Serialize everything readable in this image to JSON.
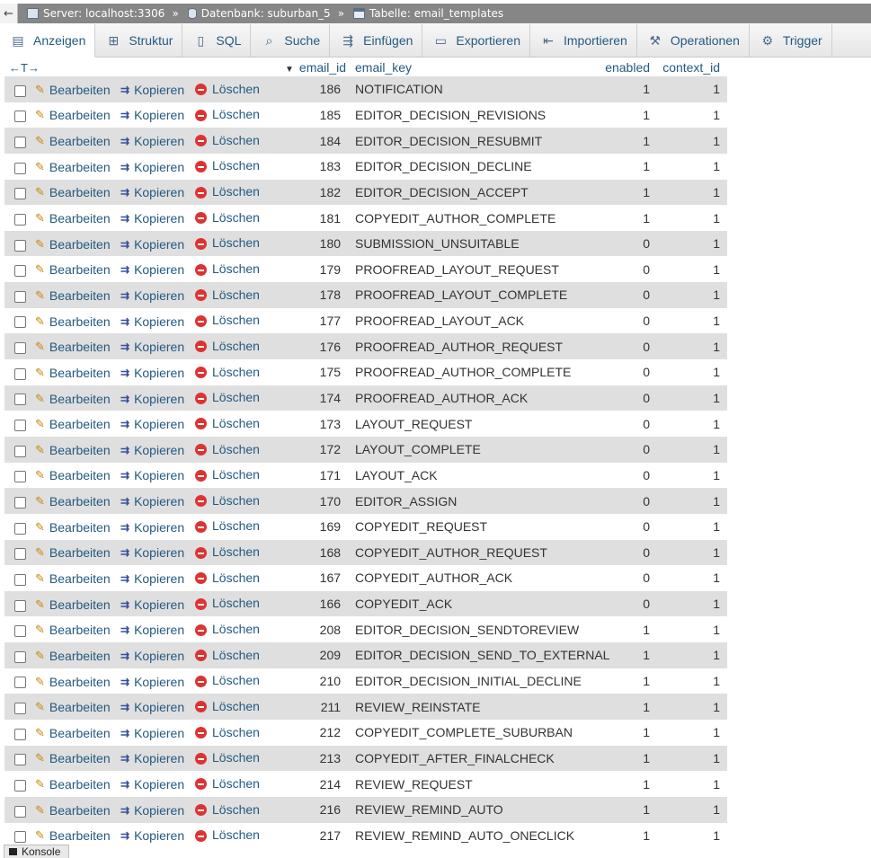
{
  "breadcrumb": {
    "back": "←",
    "server": "Server: localhost:3306",
    "database": "Datenbank: suburban_5",
    "table": "Tabelle: email_templates",
    "separator": "»"
  },
  "tabs": [
    {
      "label": "Anzeigen",
      "icon": "browse-icon",
      "glyph": "▤",
      "active": true
    },
    {
      "label": "Struktur",
      "icon": "structure-icon",
      "glyph": "⊞",
      "active": false
    },
    {
      "label": "SQL",
      "icon": "sql-icon",
      "glyph": "▯",
      "active": false
    },
    {
      "label": "Suche",
      "icon": "search-icon",
      "glyph": "⌕",
      "active": false
    },
    {
      "label": "Einfügen",
      "icon": "insert-icon",
      "glyph": "⇶",
      "active": false
    },
    {
      "label": "Exportieren",
      "icon": "export-icon",
      "glyph": "▭",
      "active": false
    },
    {
      "label": "Importieren",
      "icon": "import-icon",
      "glyph": "⇤",
      "active": false
    },
    {
      "label": "Operationen",
      "icon": "operations-icon",
      "glyph": "⚒",
      "active": false
    },
    {
      "label": "Trigger",
      "icon": "trigger-icon",
      "glyph": "⚙",
      "active": false
    }
  ],
  "table": {
    "resize_glyph": "←T→",
    "sort_glyph": "▼",
    "columns": {
      "email_id": "email_id",
      "email_key": "email_key",
      "enabled": "enabled",
      "context_id": "context_id"
    },
    "actions": {
      "edit": "Bearbeiten",
      "copy": "Kopieren",
      "delete": "Löschen"
    },
    "rows": [
      {
        "email_id": "186",
        "email_key": "NOTIFICATION",
        "enabled": "1",
        "context_id": "1"
      },
      {
        "email_id": "185",
        "email_key": "EDITOR_DECISION_REVISIONS",
        "enabled": "1",
        "context_id": "1"
      },
      {
        "email_id": "184",
        "email_key": "EDITOR_DECISION_RESUBMIT",
        "enabled": "1",
        "context_id": "1"
      },
      {
        "email_id": "183",
        "email_key": "EDITOR_DECISION_DECLINE",
        "enabled": "1",
        "context_id": "1"
      },
      {
        "email_id": "182",
        "email_key": "EDITOR_DECISION_ACCEPT",
        "enabled": "1",
        "context_id": "1"
      },
      {
        "email_id": "181",
        "email_key": "COPYEDIT_AUTHOR_COMPLETE",
        "enabled": "1",
        "context_id": "1"
      },
      {
        "email_id": "180",
        "email_key": "SUBMISSION_UNSUITABLE",
        "enabled": "0",
        "context_id": "1"
      },
      {
        "email_id": "179",
        "email_key": "PROOFREAD_LAYOUT_REQUEST",
        "enabled": "0",
        "context_id": "1"
      },
      {
        "email_id": "178",
        "email_key": "PROOFREAD_LAYOUT_COMPLETE",
        "enabled": "0",
        "context_id": "1"
      },
      {
        "email_id": "177",
        "email_key": "PROOFREAD_LAYOUT_ACK",
        "enabled": "0",
        "context_id": "1"
      },
      {
        "email_id": "176",
        "email_key": "PROOFREAD_AUTHOR_REQUEST",
        "enabled": "0",
        "context_id": "1"
      },
      {
        "email_id": "175",
        "email_key": "PROOFREAD_AUTHOR_COMPLETE",
        "enabled": "0",
        "context_id": "1"
      },
      {
        "email_id": "174",
        "email_key": "PROOFREAD_AUTHOR_ACK",
        "enabled": "0",
        "context_id": "1"
      },
      {
        "email_id": "173",
        "email_key": "LAYOUT_REQUEST",
        "enabled": "0",
        "context_id": "1"
      },
      {
        "email_id": "172",
        "email_key": "LAYOUT_COMPLETE",
        "enabled": "0",
        "context_id": "1"
      },
      {
        "email_id": "171",
        "email_key": "LAYOUT_ACK",
        "enabled": "0",
        "context_id": "1"
      },
      {
        "email_id": "170",
        "email_key": "EDITOR_ASSIGN",
        "enabled": "0",
        "context_id": "1"
      },
      {
        "email_id": "169",
        "email_key": "COPYEDIT_REQUEST",
        "enabled": "0",
        "context_id": "1"
      },
      {
        "email_id": "168",
        "email_key": "COPYEDIT_AUTHOR_REQUEST",
        "enabled": "0",
        "context_id": "1"
      },
      {
        "email_id": "167",
        "email_key": "COPYEDIT_AUTHOR_ACK",
        "enabled": "0",
        "context_id": "1"
      },
      {
        "email_id": "166",
        "email_key": "COPYEDIT_ACK",
        "enabled": "0",
        "context_id": "1"
      },
      {
        "email_id": "208",
        "email_key": "EDITOR_DECISION_SENDTOREVIEW",
        "enabled": "1",
        "context_id": "1"
      },
      {
        "email_id": "209",
        "email_key": "EDITOR_DECISION_SEND_TO_EXTERNAL",
        "enabled": "1",
        "context_id": "1"
      },
      {
        "email_id": "210",
        "email_key": "EDITOR_DECISION_INITIAL_DECLINE",
        "enabled": "1",
        "context_id": "1"
      },
      {
        "email_id": "211",
        "email_key": "REVIEW_REINSTATE",
        "enabled": "1",
        "context_id": "1"
      },
      {
        "email_id": "212",
        "email_key": "COPYEDIT_COMPLETE_SUBURBAN",
        "enabled": "1",
        "context_id": "1"
      },
      {
        "email_id": "213",
        "email_key": "COPYEDIT_AFTER_FINALCHECK",
        "enabled": "1",
        "context_id": "1"
      },
      {
        "email_id": "214",
        "email_key": "REVIEW_REQUEST",
        "enabled": "1",
        "context_id": "1"
      },
      {
        "email_id": "216",
        "email_key": "REVIEW_REMIND_AUTO",
        "enabled": "1",
        "context_id": "1"
      },
      {
        "email_id": "217",
        "email_key": "REVIEW_REMIND_AUTO_ONECLICK",
        "enabled": "1",
        "context_id": "1"
      }
    ]
  },
  "console": {
    "label": "Konsole"
  },
  "colors": {
    "link": "#235a81",
    "row_odd": "#dfdfdf",
    "breadcrumb_bg": "#868686",
    "delete_icon": "#dd3333",
    "edit_icon": "#c78a0a"
  }
}
